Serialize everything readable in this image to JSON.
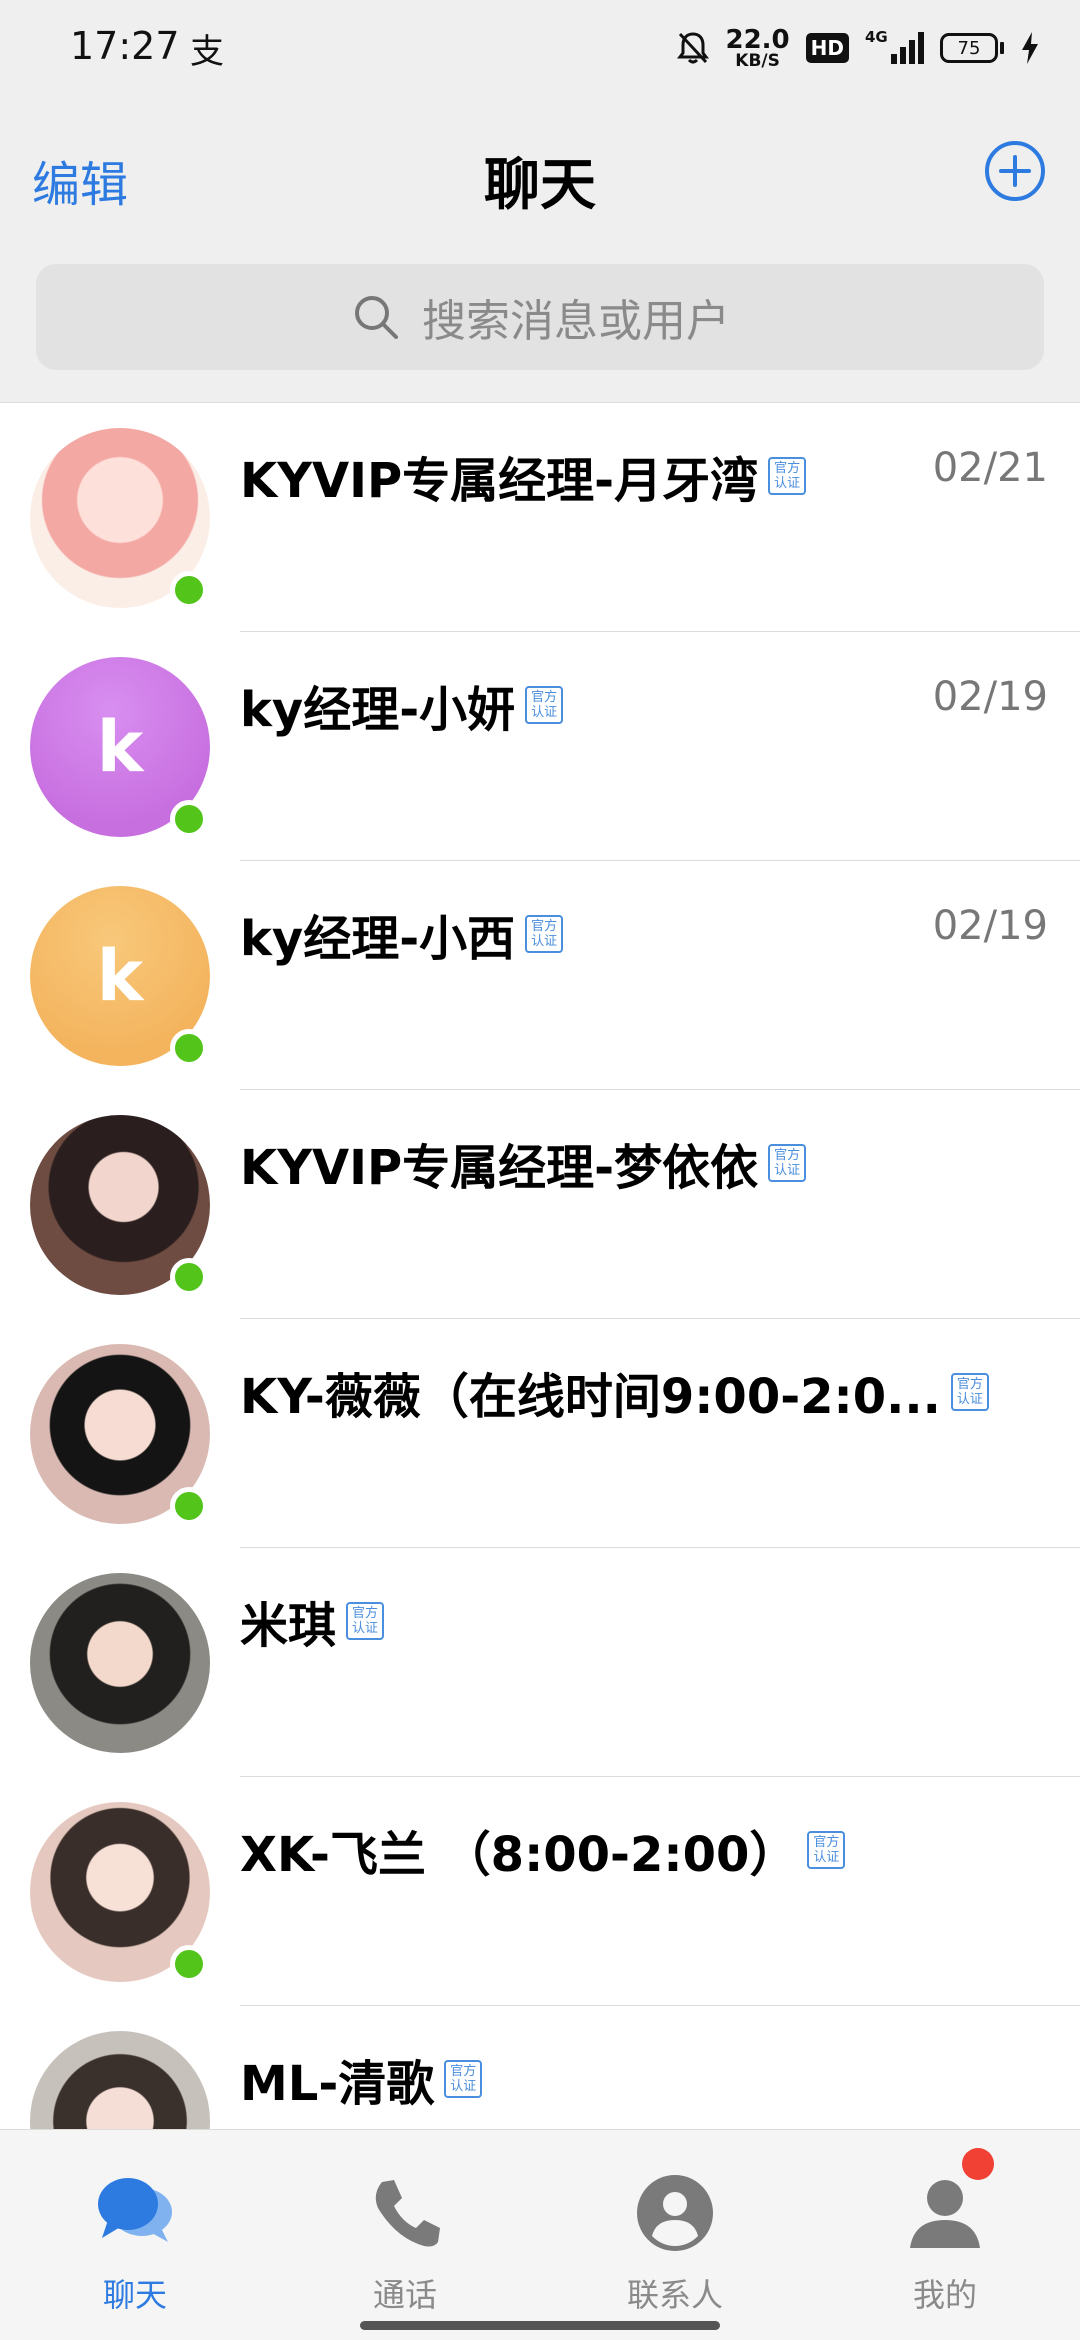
{
  "status_bar": {
    "time": "17:27",
    "app_glyph": "支",
    "net_speed_value": "22.0",
    "net_speed_unit": "KB/S",
    "hd": "HD",
    "network": "4G",
    "battery": "75"
  },
  "header": {
    "edit_label": "编辑",
    "title": "聊天"
  },
  "search": {
    "placeholder": "搜索消息或用户"
  },
  "verify_badge": {
    "line1": "官方",
    "line2": "认证"
  },
  "chats": [
    {
      "name": "KYVIP专属经理-月牙湾",
      "date": "02/21",
      "avatar": "photo",
      "online": true
    },
    {
      "name": "ky经理-小妍",
      "date": "02/19",
      "avatar": "k",
      "avatar_color": "#c86fe0",
      "online": true
    },
    {
      "name": "ky经理-小西",
      "date": "02/19",
      "avatar": "k",
      "avatar_color": "#f4b45e",
      "online": true
    },
    {
      "name": "KYVIP专属经理-梦依依",
      "date": "",
      "avatar": "photo",
      "online": true
    },
    {
      "name": "KY-薇薇（在线时间9:00-2:0...",
      "date": "",
      "avatar": "photo",
      "online": true
    },
    {
      "name": "米琪",
      "date": "",
      "avatar": "photo",
      "online": false
    },
    {
      "name": "XK-飞兰 （8:00-2:00）",
      "date": "",
      "avatar": "photo",
      "online": true
    },
    {
      "name": "ML-清歌",
      "date": "",
      "avatar": "photo",
      "online": false
    }
  ],
  "tabs": [
    {
      "label": "聊天",
      "icon": "chat-bubbles-icon",
      "active": true
    },
    {
      "label": "通话",
      "icon": "phone-icon",
      "active": false
    },
    {
      "label": "联系人",
      "icon": "contacts-icon",
      "active": false
    },
    {
      "label": "我的",
      "icon": "profile-icon",
      "active": false,
      "badge": true
    }
  ],
  "colors": {
    "accent": "#2d7be0",
    "online": "#52c41a",
    "notification": "#f04134"
  }
}
